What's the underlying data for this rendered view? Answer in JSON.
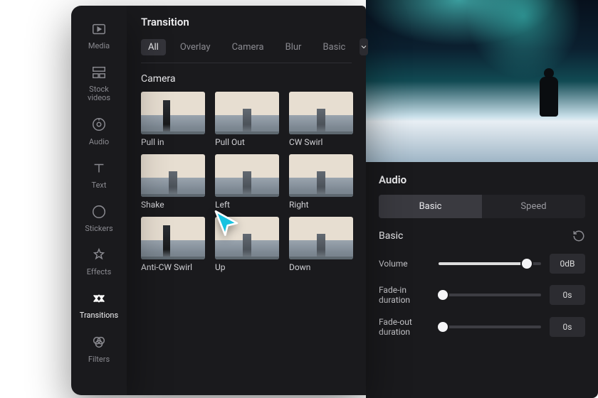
{
  "rail": [
    {
      "id": "media",
      "label": "Media",
      "icon": "media-icon"
    },
    {
      "id": "stockvideos",
      "label": "Stock\nvideos",
      "icon": "stock-icon"
    },
    {
      "id": "audio",
      "label": "Audio",
      "icon": "audio-icon"
    },
    {
      "id": "text",
      "label": "Text",
      "icon": "text-icon"
    },
    {
      "id": "stickers",
      "label": "Stickers",
      "icon": "stickers-icon"
    },
    {
      "id": "effects",
      "label": "Effects",
      "icon": "effects-icon"
    },
    {
      "id": "transitions",
      "label": "Transitions",
      "icon": "transitions-icon",
      "active": true
    },
    {
      "id": "filters",
      "label": "Filters",
      "icon": "filters-icon"
    }
  ],
  "panel": {
    "title": "Transition",
    "tabs": [
      "All",
      "Overlay",
      "Camera",
      "Blur",
      "Basic"
    ],
    "active_tab": "All",
    "section": "Camera",
    "items": [
      {
        "label": "Pull in",
        "variant": "tall"
      },
      {
        "label": "Pull Out",
        "variant": ""
      },
      {
        "label": "CW Swirl",
        "variant": ""
      },
      {
        "label": "Shake",
        "variant": ""
      },
      {
        "label": "Left",
        "variant": ""
      },
      {
        "label": "Right",
        "variant": ""
      },
      {
        "label": "Anti-CW Swirl",
        "variant": "tall"
      },
      {
        "label": "Up",
        "variant": ""
      },
      {
        "label": "Down",
        "variant": ""
      }
    ]
  },
  "audio": {
    "title": "Audio",
    "segments": [
      "Basic",
      "Speed"
    ],
    "active_segment": "Basic",
    "subhead": "Basic",
    "controls": [
      {
        "label": "Volume",
        "value": "0dB",
        "fill": 0.86,
        "knob": 0.86
      },
      {
        "label": "Fade-in duration",
        "value": "0s",
        "fill": 0.0,
        "knob": 0.04
      },
      {
        "label": "Fade-out duration",
        "value": "0s",
        "fill": 0.0,
        "knob": 0.04
      }
    ]
  }
}
